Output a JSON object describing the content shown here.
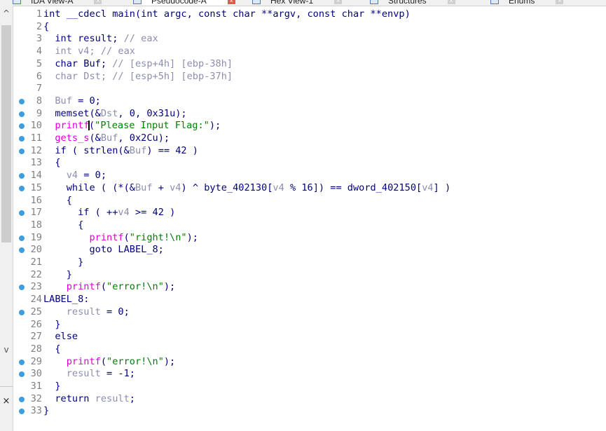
{
  "tabs": [
    {
      "label": "IDA View-A",
      "active": false
    },
    {
      "label": "Pseudocode-A",
      "active": true
    },
    {
      "label": "Hex View-1",
      "active": false
    },
    {
      "label": "Structures",
      "active": false
    },
    {
      "label": "Enums",
      "active": false
    }
  ],
  "scrollbar": {
    "up": "^",
    "down": "v",
    "close": "×"
  },
  "code_lines": [
    {
      "n": "1",
      "bp": false,
      "parts": [
        [
          "k",
          "int __cdecl main(int argc, const char **argv, const char **envp)"
        ]
      ]
    },
    {
      "n": "2",
      "bp": false,
      "parts": [
        [
          "k",
          "{"
        ]
      ]
    },
    {
      "n": "3",
      "bp": false,
      "parts": [
        [
          "k",
          "  int result; "
        ],
        [
          "c",
          "// eax"
        ]
      ]
    },
    {
      "n": "4",
      "bp": false,
      "parts": [
        [
          "v",
          "  int v4; "
        ],
        [
          "c",
          "// eax"
        ]
      ]
    },
    {
      "n": "5",
      "bp": false,
      "parts": [
        [
          "k",
          "  char Buf; "
        ],
        [
          "c",
          "// [esp+4h] [ebp-38h]"
        ]
      ]
    },
    {
      "n": "6",
      "bp": false,
      "parts": [
        [
          "v",
          "  char Dst; "
        ],
        [
          "c",
          "// [esp+5h] [ebp-37h]"
        ]
      ]
    },
    {
      "n": "7",
      "bp": false,
      "parts": []
    },
    {
      "n": "8",
      "bp": true,
      "parts": [
        [
          "v",
          "  Buf"
        ],
        [
          "k",
          " = 0;"
        ]
      ]
    },
    {
      "n": "9",
      "bp": true,
      "parts": [
        [
          "k",
          "  memset(&"
        ],
        [
          "v",
          "Dst"
        ],
        [
          "k",
          ", 0, 0x31u);"
        ]
      ]
    },
    {
      "n": "10",
      "bp": true,
      "parts": [
        [
          "f",
          "  printf"
        ],
        [
          "cursor",
          ""
        ],
        [
          "k",
          "("
        ],
        [
          "s",
          "\"Please Input Flag:\""
        ],
        [
          "k",
          ");"
        ]
      ]
    },
    {
      "n": "11",
      "bp": true,
      "parts": [
        [
          "f",
          "  gets_s"
        ],
        [
          "k",
          "(&"
        ],
        [
          "v",
          "Buf"
        ],
        [
          "k",
          ", 0x2Cu);"
        ]
      ]
    },
    {
      "n": "12",
      "bp": true,
      "parts": [
        [
          "k",
          "  if ( strlen(&"
        ],
        [
          "v",
          "Buf"
        ],
        [
          "k",
          ") == 42 )"
        ]
      ]
    },
    {
      "n": "13",
      "bp": false,
      "parts": [
        [
          "k",
          "  {"
        ]
      ]
    },
    {
      "n": "14",
      "bp": true,
      "parts": [
        [
          "v",
          "    v4"
        ],
        [
          "k",
          " = 0;"
        ]
      ]
    },
    {
      "n": "15",
      "bp": true,
      "parts": [
        [
          "k",
          "    while ( (*(&"
        ],
        [
          "v",
          "Buf"
        ],
        [
          "k",
          " + "
        ],
        [
          "v",
          "v4"
        ],
        [
          "k",
          ") ^ byte_402130["
        ],
        [
          "v",
          "v4"
        ],
        [
          "k",
          " % 16]) == dword_402150["
        ],
        [
          "v",
          "v4"
        ],
        [
          "k",
          "] )"
        ]
      ]
    },
    {
      "n": "16",
      "bp": false,
      "parts": [
        [
          "k",
          "    {"
        ]
      ]
    },
    {
      "n": "17",
      "bp": true,
      "parts": [
        [
          "k",
          "      if ( ++"
        ],
        [
          "v",
          "v4"
        ],
        [
          "k",
          " >= 42 )"
        ]
      ]
    },
    {
      "n": "18",
      "bp": false,
      "parts": [
        [
          "k",
          "      {"
        ]
      ]
    },
    {
      "n": "19",
      "bp": true,
      "parts": [
        [
          "f",
          "        printf"
        ],
        [
          "k",
          "("
        ],
        [
          "s",
          "\"right!\\n\""
        ],
        [
          "k",
          ");"
        ]
      ]
    },
    {
      "n": "20",
      "bp": true,
      "parts": [
        [
          "k",
          "        goto LABEL_8;"
        ]
      ]
    },
    {
      "n": "21",
      "bp": false,
      "parts": [
        [
          "k",
          "      }"
        ]
      ]
    },
    {
      "n": "22",
      "bp": false,
      "parts": [
        [
          "k",
          "    }"
        ]
      ]
    },
    {
      "n": "23",
      "bp": true,
      "parts": [
        [
          "f",
          "    printf"
        ],
        [
          "k",
          "("
        ],
        [
          "s",
          "\"error!\\n\""
        ],
        [
          "k",
          ");"
        ]
      ]
    },
    {
      "n": "24",
      "bp": false,
      "parts": [
        [
          "k",
          "LABEL_8:"
        ]
      ]
    },
    {
      "n": "25",
      "bp": true,
      "parts": [
        [
          "v",
          "    result"
        ],
        [
          "k",
          " = 0;"
        ]
      ]
    },
    {
      "n": "26",
      "bp": false,
      "parts": [
        [
          "k",
          "  }"
        ]
      ]
    },
    {
      "n": "27",
      "bp": false,
      "parts": [
        [
          "k",
          "  else"
        ]
      ]
    },
    {
      "n": "28",
      "bp": false,
      "parts": [
        [
          "k",
          "  {"
        ]
      ]
    },
    {
      "n": "29",
      "bp": true,
      "parts": [
        [
          "f",
          "    printf"
        ],
        [
          "k",
          "("
        ],
        [
          "s",
          "\"error!\\n\""
        ],
        [
          "k",
          ");"
        ]
      ]
    },
    {
      "n": "30",
      "bp": true,
      "parts": [
        [
          "v",
          "    result"
        ],
        [
          "k",
          " = -1;"
        ]
      ]
    },
    {
      "n": "31",
      "bp": false,
      "parts": [
        [
          "k",
          "  }"
        ]
      ]
    },
    {
      "n": "32",
      "bp": true,
      "parts": [
        [
          "k",
          "  return "
        ],
        [
          "v",
          "result"
        ],
        [
          "k",
          ";"
        ]
      ]
    },
    {
      "n": "33",
      "bp": true,
      "parts": [
        [
          "k",
          "}"
        ]
      ]
    }
  ],
  "colors": {
    "keyword": "#000080",
    "variable": "#8d8db0",
    "function": "#e000d6",
    "string": "#008000",
    "breakpoint": "#3d9ddf"
  }
}
